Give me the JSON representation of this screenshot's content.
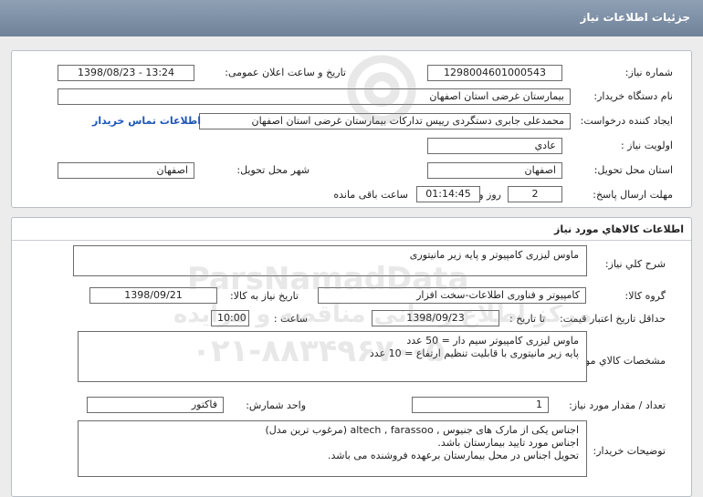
{
  "header": {
    "title": "جزئیات اطلاعات نیاز"
  },
  "need_info": {
    "need_number_label": "شماره نیاز:",
    "need_number": "1298004601000543",
    "announce_label": "تاریخ و ساعت اعلان عمومی:",
    "announce_value": "1398/08/23 - 13:24",
    "buyer_org_label": "نام دستگاه خریدار:",
    "buyer_org": "بیمارستان غرضی استان اصفهان",
    "creator_label": "ایجاد کننده درخواست:",
    "creator": "محمدعلی جابری دستگردی رییس تدارکات بیمارستان غرضی استان اصفهان",
    "contact_link": "اطلاعات تماس خریدار",
    "priority_label": "اولویت نیاز :",
    "priority": "عادي",
    "province_label": "استان محل تحویل:",
    "province": "اصفهان",
    "city_label": "شهر محل تحویل:",
    "city": "اصفهان",
    "deadline_label": "مهلت ارسال پاسخ:",
    "deadline_days": "2",
    "days_word": "روز و",
    "deadline_time": "01:14:45",
    "remaining_word": "ساعت باقی مانده"
  },
  "goods": {
    "section_title": "اطلاعات کالاهاي مورد نياز",
    "general_desc_label": "شرح کلي نياز:",
    "general_desc": "ماوس لیزری کامپیوتر و پایه زیر مانیتوری",
    "group_label": "گروه کالا:",
    "group": "کامپیوتر و فناوری اطلاعات-سخت افزار",
    "need_date_label": "تاریخ نیاز به کالا:",
    "need_date": "1398/09/21",
    "min_validity_label": "حداقل تاریخ اعتبار قیمت:",
    "until_date_label": "تا تاریخ :",
    "until_date": "1398/09/23",
    "time_label": "ساعت :",
    "time_value": "10:00",
    "specs_label": "مشخصات کالاي مورد نياز:",
    "specs": "ماوس لیزری کامپیوتر سیم دار = 50 عدد\nپایه زیر مانیتوری با قابلیت تنظیم ارتفاع = 10 عدد",
    "qty_label": "تعداد / مقدار مورد نیاز:",
    "qty": "1",
    "unit_label": "واحد شمارش:",
    "unit": "فاکتور",
    "buyer_notes_label": "توضیحات خریدار:",
    "buyer_notes": "اجناس یکی از مارک های جنیوس , altech , farassoo (مرغوب ترین مدل)\nاجناس مورد تایید بیمارستان باشد.\nتحویل اجناس در محل بیمارستان برعهده فروشنده می باشد."
  },
  "watermark": {
    "brand": "ParsNamadData",
    "tagline": "مرکز اطلاع رسانی مناقصه و مزایده",
    "phone": "۰۲۱-۸۸۳۴۹۶۷۰-۵"
  }
}
